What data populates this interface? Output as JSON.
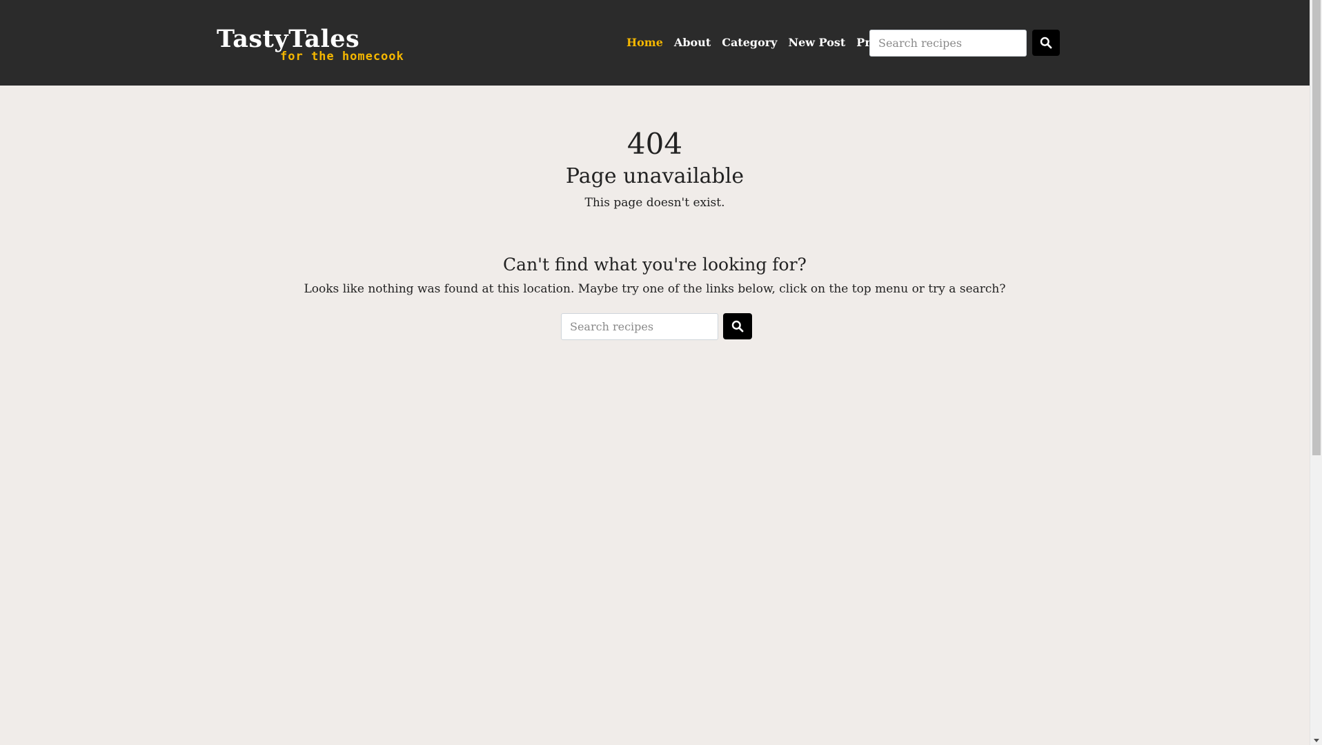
{
  "brand": {
    "name": "TastyTales",
    "tagline": "for the homecook"
  },
  "nav": {
    "items": [
      {
        "label": "Home",
        "active": true
      },
      {
        "label": "About",
        "active": false
      },
      {
        "label": "Category",
        "active": false
      },
      {
        "label": "New Post",
        "active": false
      },
      {
        "label": "Profile",
        "active": false,
        "dropdown": true
      }
    ],
    "search": {
      "placeholder": "Search recipes",
      "value": "",
      "button_icon": "search-icon"
    }
  },
  "error": {
    "code": "404",
    "title": "Page unavailable",
    "message": "This page doesn't exist."
  },
  "lost": {
    "heading": "Can't find what you're looking for?",
    "text": "Looks like nothing was found at this location. Maybe try one of the links below, click on the top menu or try a search?",
    "search": {
      "placeholder": "Search recipes",
      "value": "",
      "button_icon": "search-icon"
    }
  },
  "colors": {
    "navbar_bg": "#2b2b2b",
    "accent": "#f5b700",
    "page_bg": "#f0ece9",
    "button_bg": "#000000"
  }
}
